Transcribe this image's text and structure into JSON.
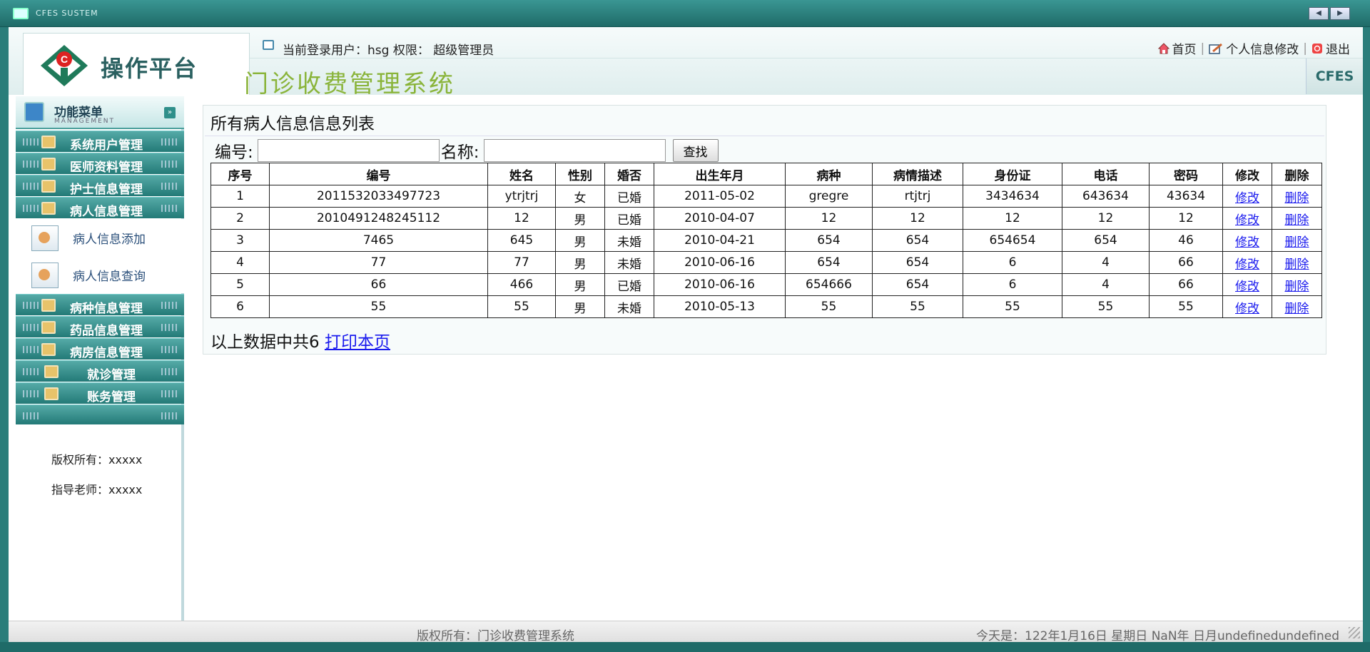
{
  "window": {
    "title": "CFES SUSTEM",
    "nav_prev": "◀",
    "nav_next": "▶"
  },
  "header": {
    "logo_text": "操作平台",
    "user_info": "当前登录用户：hsg 权限：  超级管理员",
    "system_title": "门诊收费管理系统",
    "badge": "CFES",
    "links": {
      "home": "首页",
      "profile": "个人信息修改",
      "logout": "退出"
    }
  },
  "sidebar": {
    "title": "功能菜单",
    "subtitle": "MANAGEMENT",
    "toggle": "»",
    "items_top": [
      {
        "label": "系统用户管理"
      },
      {
        "label": "医师资料管理"
      },
      {
        "label": "护士信息管理"
      },
      {
        "label": "病人信息管理"
      }
    ],
    "subitems": [
      {
        "label": "病人信息添加"
      },
      {
        "label": "病人信息查询"
      }
    ],
    "items_bottom": [
      {
        "label": "病种信息管理"
      },
      {
        "label": "药品信息管理"
      },
      {
        "label": "病房信息管理"
      },
      {
        "label": "就诊管理"
      },
      {
        "label": "账务管理"
      }
    ],
    "copyright": "版权所有：xxxxx",
    "teacher": "指导老师：xxxxx"
  },
  "main": {
    "list_title": "所有病人信息信息列表",
    "search": {
      "id_label": "编号:",
      "id_value": "",
      "name_label": "名称:",
      "name_value": "",
      "button": "查找"
    },
    "table": {
      "headers": [
        "序号",
        "编号",
        "姓名",
        "性别",
        "婚否",
        "出生年月",
        "病种",
        "病情描述",
        "身份证",
        "电话",
        "密码",
        "修改",
        "删除"
      ],
      "rows": [
        [
          "1",
          "2011532033497723",
          "ytrjtrj",
          "女",
          "已婚",
          "2011-05-02",
          "gregre",
          "rtjtrj",
          "3434634",
          "643634",
          "43634",
          "修改",
          "删除"
        ],
        [
          "2",
          "2010491248245112",
          "12",
          "男",
          "已婚",
          "2010-04-07",
          "12",
          "12",
          "12",
          "12",
          "12",
          "修改",
          "删除"
        ],
        [
          "3",
          "7465",
          "645",
          "男",
          "未婚",
          "2010-04-21",
          "654",
          "654",
          "654654",
          "654",
          "46",
          "修改",
          "删除"
        ],
        [
          "4",
          "77",
          "77",
          "男",
          "未婚",
          "2010-06-16",
          "654",
          "654",
          "6",
          "4",
          "66",
          "修改",
          "删除"
        ],
        [
          "5",
          "66",
          "466",
          "男",
          "已婚",
          "2010-06-16",
          "654666",
          "654",
          "6",
          "4",
          "66",
          "修改",
          "删除"
        ],
        [
          "6",
          "55",
          "55",
          "男",
          "未婚",
          "2010-05-13",
          "55",
          "55",
          "55",
          "55",
          "55",
          "修改",
          "删除"
        ]
      ]
    },
    "summary_text": "以上数据中共6",
    "print_link": "打印本页"
  },
  "status": {
    "copyright": "版权所有：门诊收费管理系统",
    "date_text": "今天是：122年1月16日 星期日 NaN年 日月undefinedundefined"
  }
}
